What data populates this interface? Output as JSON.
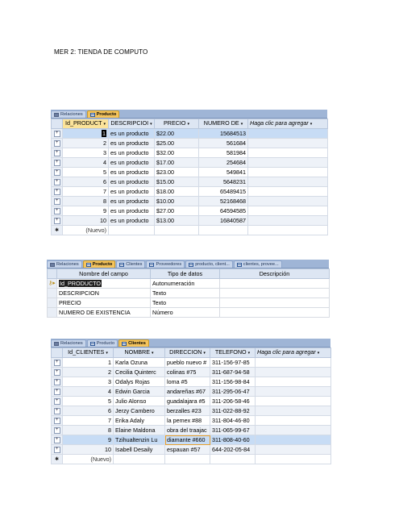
{
  "document": {
    "title": "MER 2: TIENDA DE COMPUTO"
  },
  "producto_view": {
    "tabs": [
      {
        "label": "Relaciones",
        "icon": "relationships-icon",
        "active": false
      },
      {
        "label": "Producto",
        "icon": "table-icon",
        "active": true
      }
    ],
    "columns": [
      "Id_PRODUCT",
      "DESCRIPCIOI",
      "PRECIO",
      "NUMERO DE",
      "Haga clic para agregar"
    ],
    "rows": [
      [
        "1",
        "es un producto",
        "$22.00",
        "15684513"
      ],
      [
        "2",
        "es un producto",
        "$25.00",
        "561684"
      ],
      [
        "3",
        "es un producto",
        "$32.00",
        "581984"
      ],
      [
        "4",
        "es un producto",
        "$17.00",
        "254684"
      ],
      [
        "5",
        "es un producto",
        "$23.00",
        "549841"
      ],
      [
        "6",
        "es un producto",
        "$15.00",
        "5648231"
      ],
      [
        "7",
        "es un producto",
        "$18.00",
        "65489415"
      ],
      [
        "8",
        "es un producto",
        "$10.00",
        "52168468"
      ],
      [
        "9",
        "es un producto",
        "$27.00",
        "64594585"
      ],
      [
        "10",
        "es un producto",
        "$13.00",
        "16840587"
      ]
    ],
    "new_row_label": "(Nuevo)"
  },
  "design_view": {
    "tabs": [
      {
        "label": "Relaciones",
        "icon": "relationships-icon",
        "active": false
      },
      {
        "label": "Producto",
        "icon": "table-icon",
        "active": true
      },
      {
        "label": "Clientes",
        "icon": "table-icon",
        "active": false
      },
      {
        "label": "Proveedores",
        "icon": "table-icon",
        "active": false
      },
      {
        "label": "producto, client...",
        "icon": "query-icon",
        "active": false
      },
      {
        "label": "clientes, provee...",
        "icon": "query-icon",
        "active": false
      }
    ],
    "columns": [
      "Nombre del campo",
      "Tipo de datos",
      "Descripción"
    ],
    "fields": [
      {
        "name": "Id_PRODUCTO",
        "type": "Autonumeración",
        "description": ""
      },
      {
        "name": "DESCRIPCION",
        "type": "Texto",
        "description": ""
      },
      {
        "name": "PRECIO",
        "type": "Texto",
        "description": ""
      },
      {
        "name": "NUMERO DE EXISTENCIA",
        "type": "Número",
        "description": ""
      }
    ]
  },
  "clientes_view": {
    "tabs": [
      {
        "label": "Relaciones",
        "icon": "relationships-icon",
        "active": false
      },
      {
        "label": "Producto",
        "icon": "table-icon",
        "active": false
      },
      {
        "label": "Clientes",
        "icon": "table-icon",
        "active": true
      }
    ],
    "columns": [
      "Id_CLIENTES",
      "NOMBRE",
      "DIRECCION",
      "TELEFONO",
      "Haga clic para agregar"
    ],
    "rows": [
      [
        "1",
        "Karla Ozuna",
        "pueblo nuevo #",
        "311-156-97-85"
      ],
      [
        "2",
        "Cecilia Quinterc",
        "colinas #75",
        "311-687-94-58"
      ],
      [
        "3",
        "Odalys Rojas",
        "loma #5",
        "311-156-98-84"
      ],
      [
        "4",
        "Edwin Garcia",
        "andareñas #67",
        "311-295-06-47"
      ],
      [
        "5",
        "Julio Alonso",
        "guadalajara #5",
        "311-206-58-46"
      ],
      [
        "6",
        "Jerzy Cambero",
        "berzalles #23",
        "311-022-88-92"
      ],
      [
        "7",
        "Erika Adaly",
        "la pemex #88",
        "311-804-46-80"
      ],
      [
        "8",
        "Elaine Maldona",
        "obra del traajac",
        "311-065-99-67"
      ],
      [
        "9",
        "Tzihualtenzin Lu",
        "diamante #660",
        "311-808-40-60"
      ],
      [
        "10",
        "Isabell Desaily",
        "espauan #57",
        "644-202-05-84"
      ]
    ],
    "new_row_label": "(Nuevo)"
  }
}
